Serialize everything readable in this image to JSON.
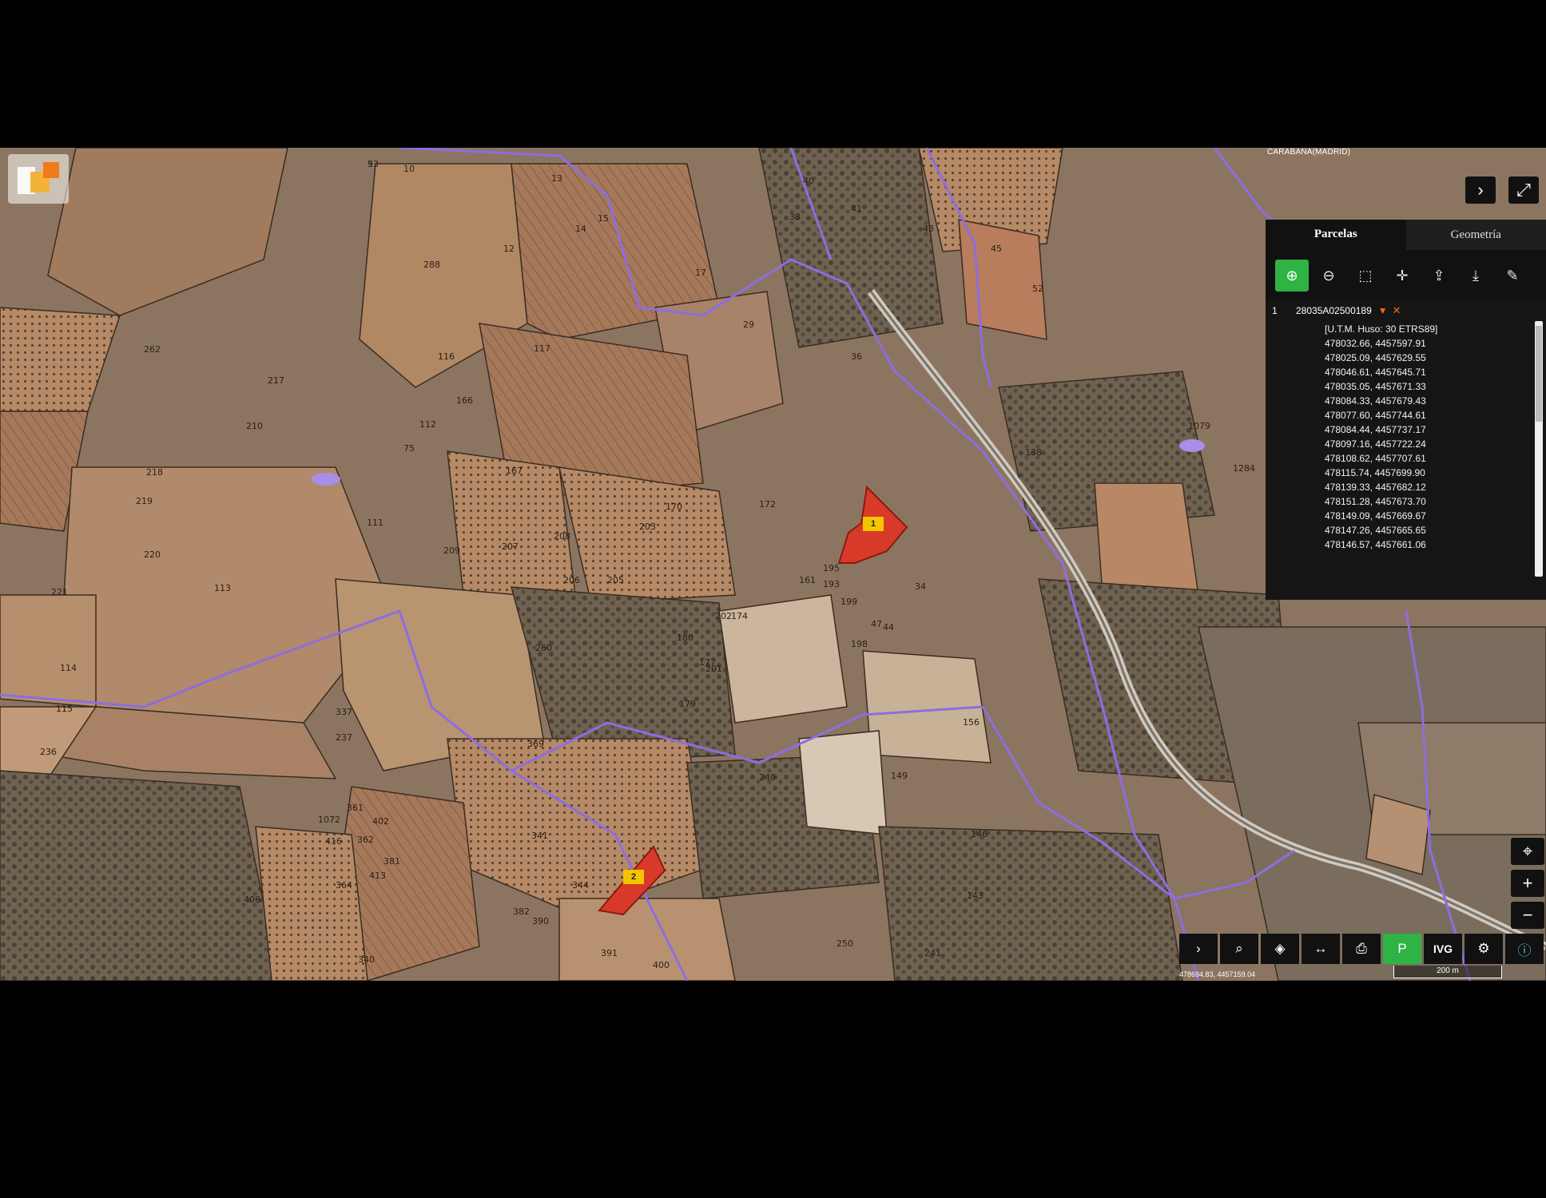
{
  "map": {
    "municipality": "CARABAÑA(MADRID)",
    "status_coords": "478694.83, 4457159.04",
    "scale_label": "200 m",
    "parcel_labels": [
      "3",
      "10",
      "288",
      "12",
      "13",
      "14",
      "15",
      "17",
      "29",
      "36",
      "38",
      "40",
      "41",
      "43",
      "45",
      "52",
      "75",
      "112",
      "111",
      "113",
      "114",
      "115",
      "116",
      "117",
      "166",
      "167",
      "170",
      "172",
      "174",
      "177",
      "179",
      "180",
      "201",
      "202",
      "203",
      "205",
      "206",
      "207",
      "208",
      "209",
      "210",
      "217",
      "218",
      "219",
      "220",
      "221",
      "236",
      "237",
      "240",
      "241",
      "250",
      "260",
      "262",
      "337",
      "340",
      "341",
      "344",
      "361",
      "362",
      "364",
      "369",
      "381",
      "382",
      "390",
      "391",
      "400",
      "402",
      "406",
      "413",
      "416",
      "1072",
      "1079",
      "1284",
      "138",
      "143",
      "146",
      "149",
      "156",
      "161",
      "193",
      "195",
      "198",
      "199",
      "34",
      "44",
      "47",
      "93"
    ],
    "markers": [
      "1",
      "2"
    ]
  },
  "panel": {
    "tabs": [
      "Parcelas",
      "Geometría"
    ],
    "parcel": {
      "index": "1",
      "ref": "28035A02500189",
      "projection": "[U.T.M. Huso: 30 ETRS89]",
      "coords": [
        "478032.66, 4457597.91",
        "478025.09, 4457629.55",
        "478046.61, 4457645.71",
        "478035.05, 4457671.33",
        "478084.33, 4457679.43",
        "478077.60, 4457744.61",
        "478084.44, 4457737.17",
        "478097.16, 4457722.24",
        "478108.62, 4457707.61",
        "478115.74, 4457699.90",
        "478139.33, 4457682.12",
        "478151.28, 4457673.70",
        "478149.09, 4457669.67",
        "478147.26, 4457665.65",
        "478146.57, 4457661.06"
      ]
    },
    "tools": [
      "add-parcel-icon",
      "remove-parcel-icon",
      "select-area-icon",
      "add-point-icon",
      "upload-icon",
      "download-icon",
      "edit-icon"
    ]
  },
  "bottom_toolbar": {
    "ivg_label": "IVG",
    "tools": [
      "chevron-right-icon",
      "search-icon",
      "layers-icon",
      "measure-icon",
      "print-icon",
      "parcel-tool-icon",
      "ivg-icon",
      "bike-icon",
      "info-icon"
    ]
  },
  "colors": {
    "accent": "#2fb344",
    "boundary": "#8c6ee0",
    "parcel_highlight": "#d83a2a",
    "marker": "#f2c500"
  }
}
